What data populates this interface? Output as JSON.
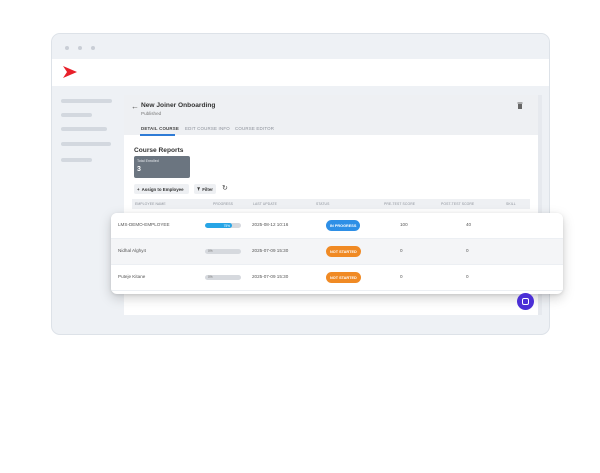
{
  "course": {
    "title": "New Joiner Onboarding",
    "status": "Published"
  },
  "tabs": [
    {
      "label": "DETAIL COURSE",
      "active": true
    },
    {
      "label": "EDIT COURSE INFO",
      "active": false
    },
    {
      "label": "COURSE EDITOR",
      "active": false
    }
  ],
  "reports": {
    "title": "Course Reports",
    "stat_label": "Total Enrolled",
    "stat_value": "3"
  },
  "toolbar": {
    "assign_label": "Assign to Employee",
    "filter_label": "Filter"
  },
  "table": {
    "columns": [
      "EMPLOYEE NAME",
      "PROGRESS",
      "LAST UPDATE",
      "STATUS",
      "PRE-TEST SCORE",
      "POST-TEST SCORE",
      "SKILL"
    ],
    "rows": [
      {
        "name": "LMS-DEMO-EMPLOYEE",
        "progress_label": "75%",
        "progress": 0.75,
        "last_update": "2025-08-12 10:16",
        "status": "IN PROGRESS",
        "pre_test": "100",
        "post_test": "40"
      },
      {
        "name": "Nidhal Alghy4",
        "progress_label": "0%",
        "progress": 0,
        "last_update": "2025-07-09 15:30",
        "status": "NOT STARTED",
        "pre_test": "0",
        "post_test": "0"
      },
      {
        "name": "Puteje Kitane",
        "progress_label": "0%",
        "progress": 0,
        "last_update": "2025-07-09 15:30",
        "status": "NOT STARTED",
        "pre_test": "0",
        "post_test": "0"
      }
    ]
  },
  "colors": {
    "in_progress": "#2e8fe6",
    "not_started": "#f08a24",
    "brand": "#e8202a",
    "chat": "#4b2fd6"
  },
  "icons": {
    "logo": "play-logo-icon",
    "back": "back-arrow-icon",
    "delete": "trash-icon",
    "assign": "plus-icon",
    "filter": "filter-icon",
    "refresh": "refresh-icon",
    "chat": "chat-icon"
  }
}
